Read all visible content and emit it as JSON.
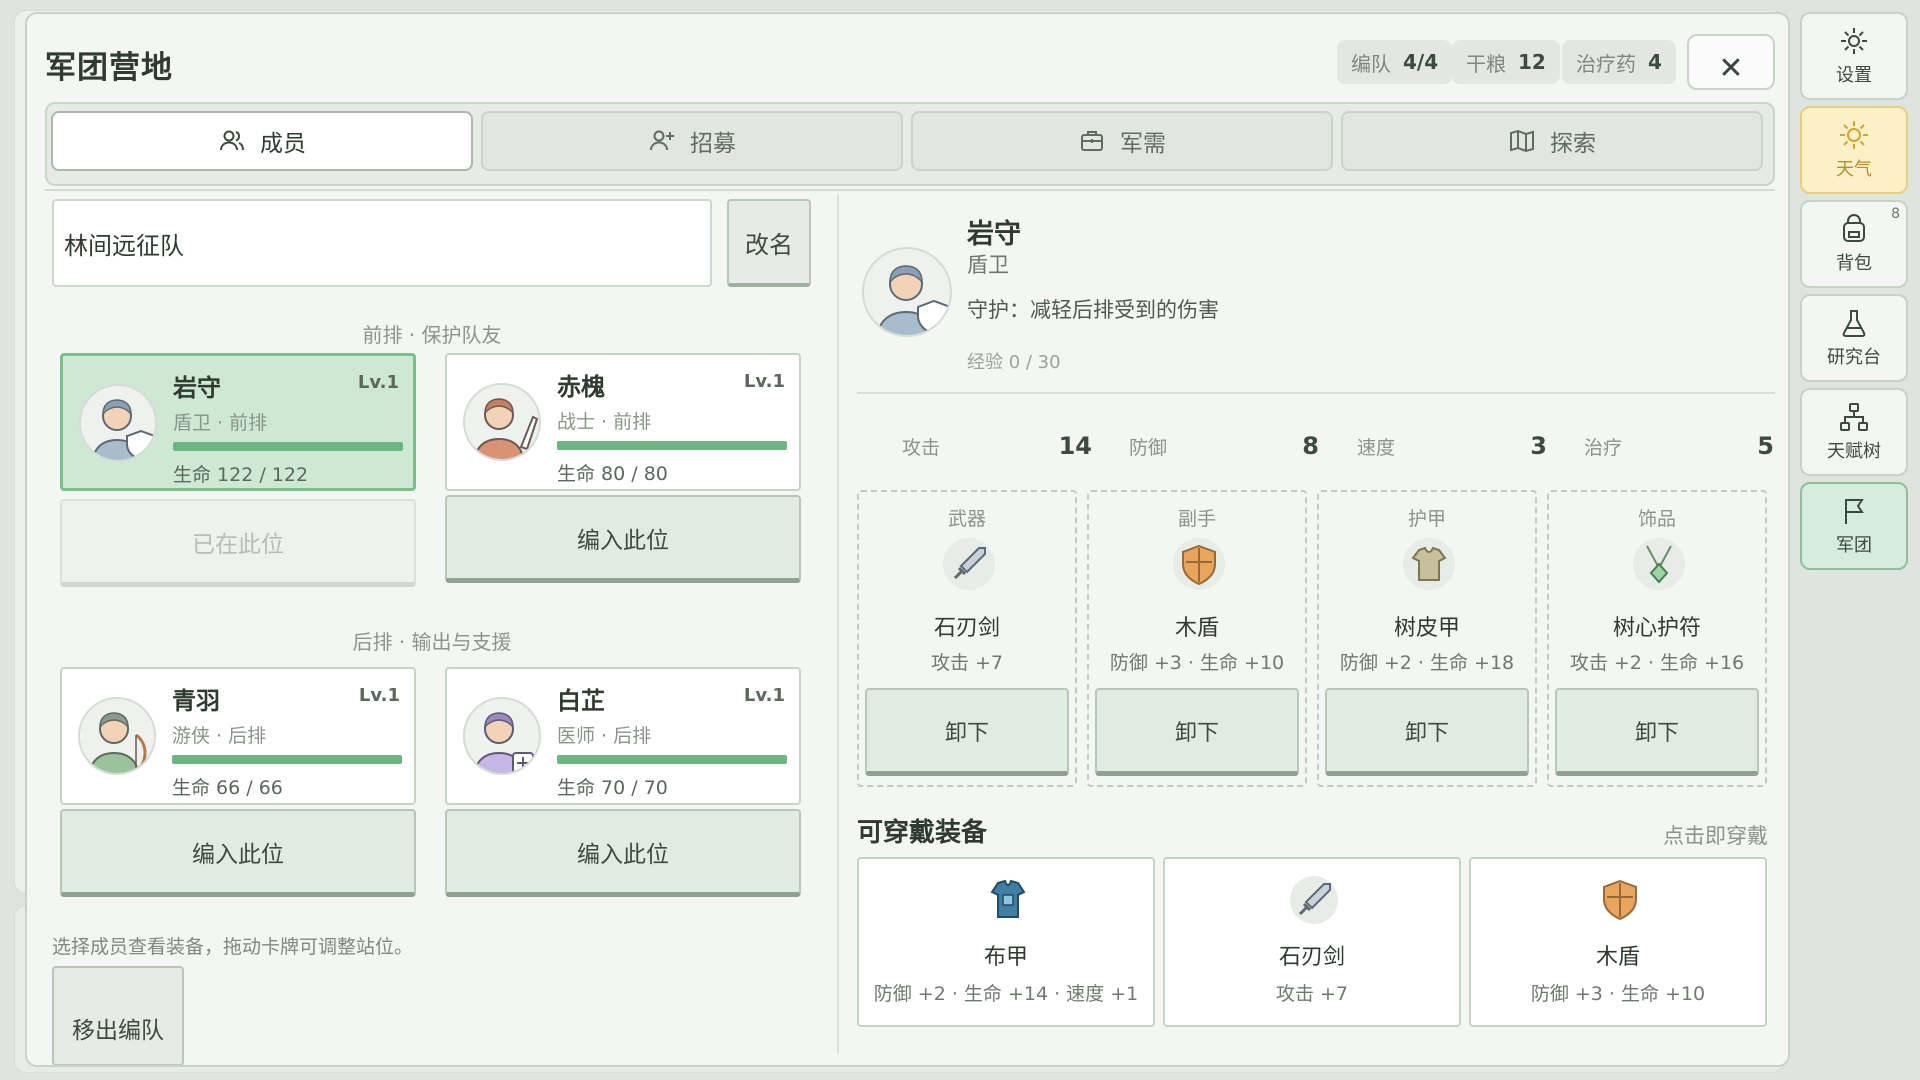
{
  "modal": {
    "title": "军团营地",
    "chips": [
      {
        "label": "编队",
        "value": "4/4"
      },
      {
        "label": "干粮",
        "value": "12"
      },
      {
        "label": "治疗药",
        "value": "4"
      }
    ],
    "close_icon": "close-icon"
  },
  "tabs": [
    {
      "label": "成员",
      "icon": "members-icon",
      "active": true
    },
    {
      "label": "招募",
      "icon": "recruit-icon",
      "active": false
    },
    {
      "label": "军需",
      "icon": "supplies-icon",
      "active": false
    },
    {
      "label": "探索",
      "icon": "map-icon",
      "active": false
    }
  ],
  "squad": {
    "name": "林间远征队",
    "rename_label": "改名",
    "front_label": "前排 · 保护队友",
    "back_label": "后排 · 输出与支援",
    "members": [
      {
        "name": "岩守",
        "level": "Lv.1",
        "sub": "盾卫 · 前排",
        "hp": "生命 122 / 122",
        "hp_fraction": 1.0,
        "slot_label": "已在此位",
        "selected": true
      },
      {
        "name": "赤槐",
        "level": "Lv.1",
        "sub": "战士 · 前排",
        "hp": "生命 80 / 80",
        "hp_fraction": 1.0,
        "slot_label": "编入此位",
        "selected": false
      },
      {
        "name": "青羽",
        "level": "Lv.1",
        "sub": "游侠 · 后排",
        "hp": "生命 66 / 66",
        "hp_fraction": 1.0,
        "slot_label": "编入此位",
        "selected": false
      },
      {
        "name": "白芷",
        "level": "Lv.1",
        "sub": "医师 · 后排",
        "hp": "生命 70 / 70",
        "hp_fraction": 1.0,
        "slot_label": "编入此位",
        "selected": false
      }
    ],
    "hint": "选择成员查看装备，拖动卡牌可调整站位。",
    "leave_label": "移出编队"
  },
  "detail": {
    "name": "岩守",
    "class": "盾卫",
    "skill": "守护：减轻后排受到的伤害",
    "exp": "经验 0 / 30",
    "stats": [
      {
        "label": "攻击",
        "value": "14"
      },
      {
        "label": "防御",
        "value": "8"
      },
      {
        "label": "速度",
        "value": "3"
      },
      {
        "label": "治疗",
        "value": "5"
      }
    ],
    "slots": [
      {
        "slot": "武器",
        "name": "石刃剑",
        "stats": "攻击 +7",
        "icon": "sword-icon",
        "action": "卸下"
      },
      {
        "slot": "副手",
        "name": "木盾",
        "stats": "防御 +3 · 生命 +10",
        "icon": "shield-icon",
        "action": "卸下"
      },
      {
        "slot": "护甲",
        "name": "树皮甲",
        "stats": "防御 +2 · 生命 +18",
        "icon": "armor-icon",
        "action": "卸下"
      },
      {
        "slot": "饰品",
        "name": "树心护符",
        "stats": "攻击 +2 · 生命 +16",
        "icon": "amulet-icon",
        "action": "卸下"
      }
    ]
  },
  "wearable": {
    "title": "可穿戴装备",
    "hint": "点击即穿戴",
    "items": [
      {
        "name": "布甲",
        "stats": "防御 +2 · 生命 +14 · 速度 +1",
        "icon": "cloth-armor-icon"
      },
      {
        "name": "石刃剑",
        "stats": "攻击 +7",
        "icon": "sword-icon"
      },
      {
        "name": "木盾",
        "stats": "防御 +3 · 生命 +10",
        "icon": "shield-icon"
      }
    ]
  },
  "sidebar": [
    {
      "label": "设置",
      "icon": "gear-icon"
    },
    {
      "label": "天气",
      "icon": "sun-icon"
    },
    {
      "label": "背包",
      "icon": "backpack-icon",
      "badge": "8"
    },
    {
      "label": "研究台",
      "icon": "flask-icon"
    },
    {
      "label": "天赋树",
      "icon": "talent-tree-icon"
    },
    {
      "label": "军团",
      "icon": "flag-icon"
    }
  ],
  "colors": {
    "accent_green": "#6db582",
    "selected_card": "#cde9d3",
    "weather_yellow": "#fbf0c8"
  }
}
